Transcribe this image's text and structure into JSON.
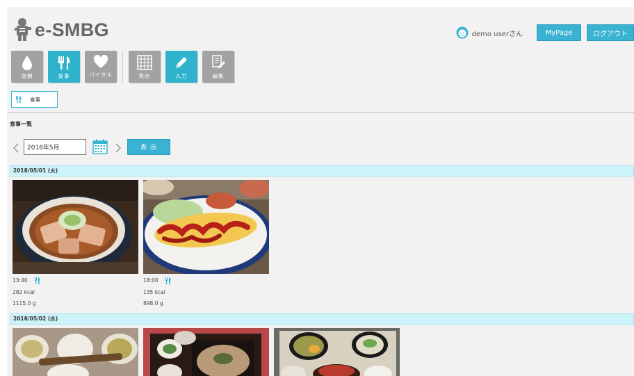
{
  "header": {
    "logo_text": "e-SMBG",
    "user_name": "demo userさん",
    "mypage_label": "MyPage",
    "logout_label": "ログアウト"
  },
  "nav_tiles": [
    {
      "label": "血糖",
      "icon": "drop-icon",
      "active": false
    },
    {
      "label": "食事",
      "icon": "fork-knife-icon",
      "active": true
    },
    {
      "label": "バイタル",
      "icon": "heart-icon",
      "active": false
    },
    {
      "label": "表示",
      "icon": "grid-icon",
      "active": false
    },
    {
      "label": "入力",
      "icon": "pencil-icon",
      "active": true
    },
    {
      "label": "編集",
      "icon": "edit-doc-icon",
      "active": false
    }
  ],
  "subtab": {
    "label": "食事"
  },
  "section_title": "食事一覧",
  "date_nav": {
    "value": "2018年5月",
    "show_label": "表 示"
  },
  "colors": {
    "accent": "#3ab3d2",
    "tile_gray": "#a2a2a2",
    "day_header_bg": "#ccf2fa"
  },
  "days": [
    {
      "date": "2018/05/01 (火)",
      "meals": [
        {
          "time": "13:40",
          "kcal": "282 kcal",
          "weight": "1115.0 g",
          "photo": "ramen-bowl"
        },
        {
          "time": "18:00",
          "kcal": "135 kcal",
          "weight": "898.0 g",
          "photo": "omurice-plate"
        }
      ]
    },
    {
      "date": "2018/05/02 (水)",
      "meals": [
        {
          "photo": "grilled-fish-set"
        },
        {
          "photo": "soba-set"
        },
        {
          "photo": "teishoku-tray"
        }
      ]
    }
  ]
}
